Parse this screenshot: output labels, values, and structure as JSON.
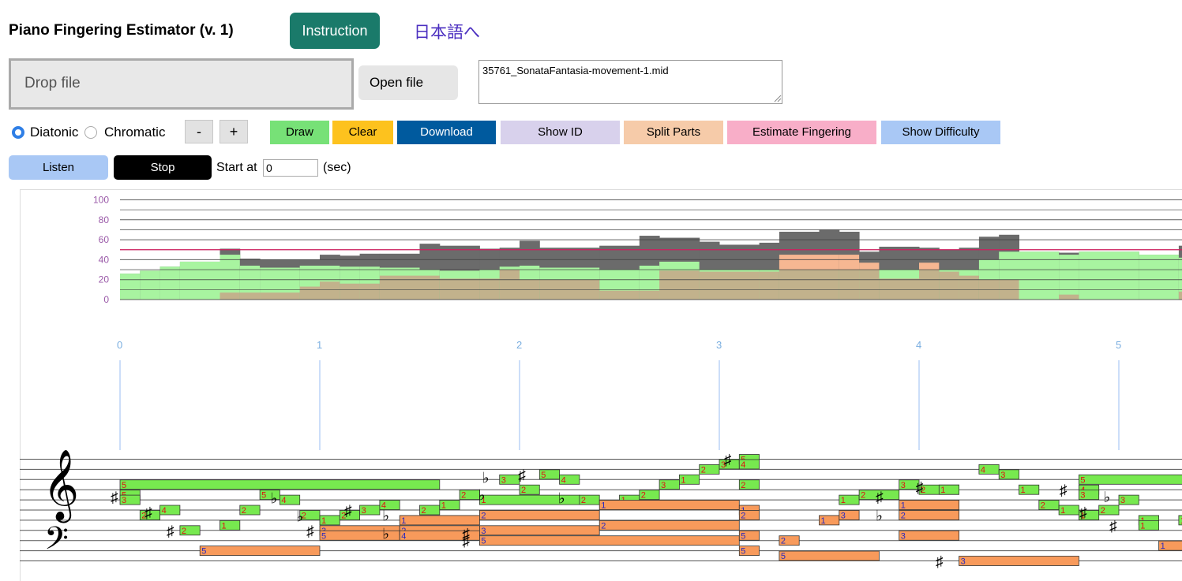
{
  "app": {
    "title": "Piano Fingering Estimator (v. 1)",
    "instruction_label": "Instruction",
    "language_link": "日本語へ"
  },
  "file": {
    "drop_label": "Drop file",
    "open_label": "Open file",
    "filename": "35761_SonataFantasia-movement-1.mid"
  },
  "controls": {
    "mode_options": [
      "Diatonic",
      "Chromatic"
    ],
    "mode_selected": "Diatonic",
    "zoom_out_label": "-",
    "zoom_in_label": "+",
    "toolbar": [
      {
        "label": "Draw",
        "color": "#77e177"
      },
      {
        "label": "Clear",
        "color": "#fdc21e"
      },
      {
        "label": "Download",
        "color": "#005a9e"
      },
      {
        "label": "Show ID",
        "color": "#d8d1ec"
      },
      {
        "label": "Split Parts",
        "color": "#f6cba9"
      },
      {
        "label": "Estimate Fingering",
        "color": "#f8aec8"
      },
      {
        "label": "Show Difficulty",
        "color": "#a9c8f5"
      }
    ],
    "listen_label": "Listen",
    "stop_label": "Stop",
    "start_at_label": "Start at",
    "start_value": "0",
    "sec_label": "(sec)"
  },
  "difficulty_chart": {
    "y_ticks": [
      "100",
      "80",
      "60",
      "40",
      "20",
      "0"
    ],
    "threshold": 50,
    "colors": {
      "total": "#6b6b6b",
      "right": "#a8f4a0",
      "left": "#c2b28c",
      "overlap": "#f6b792",
      "threshold": "#d02060"
    },
    "segments": [
      {
        "t0": 0.0,
        "t1": 0.1,
        "total": 26,
        "right": 26,
        "left": 0
      },
      {
        "t0": 0.1,
        "t1": 0.2,
        "total": 29,
        "right": 29,
        "left": 0
      },
      {
        "t0": 0.2,
        "t1": 0.3,
        "total": 33,
        "right": 33,
        "left": 0
      },
      {
        "t0": 0.3,
        "t1": 0.5,
        "total": 38,
        "right": 38,
        "left": 0
      },
      {
        "t0": 0.5,
        "t1": 0.6,
        "total": 51,
        "right": 45,
        "left": 7
      },
      {
        "t0": 0.6,
        "t1": 0.7,
        "total": 41,
        "right": 34,
        "left": 7
      },
      {
        "t0": 0.7,
        "t1": 0.9,
        "total": 40,
        "right": 32,
        "left": 7
      },
      {
        "t0": 0.9,
        "t1": 1.0,
        "total": 40,
        "right": 34,
        "left": 13
      },
      {
        "t0": 1.0,
        "t1": 1.1,
        "total": 45,
        "right": 34,
        "left": 18
      },
      {
        "t0": 1.1,
        "t1": 1.2,
        "total": 44,
        "right": 33,
        "left": 16
      },
      {
        "t0": 1.2,
        "t1": 1.3,
        "total": 46,
        "right": 33,
        "left": 16
      },
      {
        "t0": 1.3,
        "t1": 1.5,
        "total": 46,
        "right": 32,
        "left": 24
      },
      {
        "t0": 1.5,
        "t1": 1.6,
        "total": 56,
        "right": 30,
        "left": 24
      },
      {
        "t0": 1.6,
        "t1": 1.8,
        "total": 54,
        "right": 29,
        "left": 21
      },
      {
        "t0": 1.8,
        "t1": 1.9,
        "total": 51,
        "right": 30,
        "left": 21
      },
      {
        "t0": 1.9,
        "t1": 2.0,
        "total": 52,
        "right": 33,
        "left": 30
      },
      {
        "t0": 2.0,
        "t1": 2.1,
        "total": 59,
        "right": 34,
        "left": 20
      },
      {
        "t0": 2.1,
        "t1": 2.4,
        "total": 52,
        "right": 32,
        "left": 20
      },
      {
        "t0": 2.4,
        "t1": 2.6,
        "total": 54,
        "right": 30,
        "left": 9
      },
      {
        "t0": 2.6,
        "t1": 2.7,
        "total": 64,
        "right": 34,
        "left": 9
      },
      {
        "t0": 2.7,
        "t1": 2.9,
        "total": 62,
        "right": 38,
        "left": 29
      },
      {
        "t0": 2.9,
        "t1": 3.0,
        "total": 58,
        "right": 30,
        "left": 28
      },
      {
        "t0": 3.0,
        "t1": 3.2,
        "total": 55,
        "right": 30,
        "left": 28
      },
      {
        "t0": 3.2,
        "t1": 3.3,
        "total": 57,
        "right": 30,
        "left": 28
      },
      {
        "t0": 3.3,
        "t1": 3.5,
        "total": 68,
        "right": 30,
        "left": 45
      },
      {
        "t0": 3.5,
        "t1": 3.6,
        "total": 70,
        "right": 30,
        "left": 45
      },
      {
        "t0": 3.6,
        "t1": 3.7,
        "total": 68,
        "right": 30,
        "left": 45
      },
      {
        "t0": 3.7,
        "t1": 3.8,
        "total": 48,
        "right": 30,
        "left": 37
      },
      {
        "t0": 3.8,
        "t1": 4.0,
        "total": 53,
        "right": 30,
        "left": 21
      },
      {
        "t0": 4.0,
        "t1": 4.1,
        "total": 52,
        "right": 30,
        "left": 37
      },
      {
        "t0": 4.1,
        "t1": 4.2,
        "total": 50,
        "right": 30,
        "left": 28
      },
      {
        "t0": 4.2,
        "t1": 4.3,
        "total": 52,
        "right": 30,
        "left": 24
      },
      {
        "t0": 4.3,
        "t1": 4.4,
        "total": 63,
        "right": 40,
        "left": 20
      },
      {
        "t0": 4.4,
        "t1": 4.5,
        "total": 65,
        "right": 48,
        "left": 20
      },
      {
        "t0": 4.5,
        "t1": 4.7,
        "total": 48,
        "right": 48,
        "left": 0
      },
      {
        "t0": 4.7,
        "t1": 4.8,
        "total": 47,
        "right": 45,
        "left": 5
      },
      {
        "t0": 4.8,
        "t1": 5.1,
        "total": 48,
        "right": 48,
        "left": 0
      },
      {
        "t0": 5.1,
        "t1": 5.3,
        "total": 45,
        "right": 45,
        "left": 0
      },
      {
        "t0": 5.3,
        "t1": 5.4,
        "total": 54,
        "right": 42,
        "left": 8
      }
    ]
  },
  "timeline": {
    "labels": [
      "0",
      "1",
      "2",
      "3",
      "4",
      "5"
    ]
  },
  "score": {
    "colors": {
      "right_fill": "#77e94f",
      "left_fill": "#f89a5b",
      "right_text": "#e01010",
      "left_text": "#2828c0"
    },
    "notes": [
      {
        "hand": "R",
        "t0": 0.0,
        "t1": 1.6,
        "line": 2.5,
        "finger": "5"
      },
      {
        "hand": "R",
        "t0": 0.0,
        "t1": 0.1,
        "line": 3.5,
        "finger": "5"
      },
      {
        "hand": "R",
        "t0": 0.0,
        "t1": 0.1,
        "line": 4.0,
        "finger": "3"
      },
      {
        "hand": "R",
        "t0": 0.1,
        "t1": 0.2,
        "line": 5.5,
        "finger": "2"
      },
      {
        "hand": "R",
        "t0": 0.2,
        "t1": 0.3,
        "line": 5.0,
        "finger": "4"
      },
      {
        "hand": "R",
        "t0": 0.3,
        "t1": 0.4,
        "line": 7.0,
        "finger": "2"
      },
      {
        "hand": "R",
        "t0": 0.5,
        "t1": 0.6,
        "line": 6.5,
        "finger": "1"
      },
      {
        "hand": "R",
        "t0": 0.6,
        "t1": 0.7,
        "line": 5.0,
        "finger": "2"
      },
      {
        "hand": "R",
        "t0": 0.7,
        "t1": 0.8,
        "line": 3.5,
        "finger": "5"
      },
      {
        "hand": "R",
        "t0": 0.8,
        "t1": 0.9,
        "line": 4.0,
        "finger": "4"
      },
      {
        "hand": "R",
        "t0": 0.9,
        "t1": 1.0,
        "line": 5.5,
        "finger": "2"
      },
      {
        "hand": "R",
        "t0": 1.0,
        "t1": 1.1,
        "line": 6.0,
        "finger": "1"
      },
      {
        "hand": "R",
        "t0": 1.1,
        "t1": 1.2,
        "line": 5.5,
        "finger": "2"
      },
      {
        "hand": "R",
        "t0": 1.2,
        "t1": 1.3,
        "line": 5.0,
        "finger": "3"
      },
      {
        "hand": "R",
        "t0": 1.3,
        "t1": 1.4,
        "line": 4.5,
        "finger": "4"
      },
      {
        "hand": "R",
        "t0": 1.5,
        "t1": 1.6,
        "line": 5.0,
        "finger": "2"
      },
      {
        "hand": "R",
        "t0": 1.6,
        "t1": 1.7,
        "line": 4.5,
        "finger": "1"
      },
      {
        "hand": "R",
        "t0": 1.7,
        "t1": 1.8,
        "line": 3.5,
        "finger": "2"
      },
      {
        "hand": "R",
        "t0": 1.8,
        "t1": 2.3,
        "line": 4.0,
        "finger": "1"
      },
      {
        "hand": "R",
        "t0": 1.9,
        "t1": 2.0,
        "line": 2.0,
        "finger": "3"
      },
      {
        "hand": "R",
        "t0": 2.0,
        "t1": 2.1,
        "line": 3.0,
        "finger": "2"
      },
      {
        "hand": "R",
        "t0": 2.1,
        "t1": 2.2,
        "line": 1.5,
        "finger": "5"
      },
      {
        "hand": "R",
        "t0": 2.2,
        "t1": 2.3,
        "line": 2.0,
        "finger": "4"
      },
      {
        "hand": "R",
        "t0": 2.3,
        "t1": 2.4,
        "line": 4.0,
        "finger": "2"
      },
      {
        "hand": "R",
        "t0": 2.5,
        "t1": 2.6,
        "line": 4.0,
        "finger": "1"
      },
      {
        "hand": "R",
        "t0": 2.6,
        "t1": 2.7,
        "line": 3.5,
        "finger": "2"
      },
      {
        "hand": "R",
        "t0": 2.7,
        "t1": 2.8,
        "line": 2.5,
        "finger": "3"
      },
      {
        "hand": "R",
        "t0": 2.8,
        "t1": 2.9,
        "line": 2.0,
        "finger": "1"
      },
      {
        "hand": "R",
        "t0": 2.9,
        "t1": 3.0,
        "line": 1.0,
        "finger": "2"
      },
      {
        "hand": "R",
        "t0": 3.0,
        "t1": 3.1,
        "line": 0.5,
        "finger": "3"
      },
      {
        "hand": "R",
        "t0": 3.1,
        "t1": 3.2,
        "line": 0.0,
        "finger": "5"
      },
      {
        "hand": "R",
        "t0": 3.1,
        "t1": 3.2,
        "line": 0.5,
        "finger": "4"
      },
      {
        "hand": "R",
        "t0": 3.1,
        "t1": 3.2,
        "line": 2.5,
        "finger": "2"
      },
      {
        "hand": "R",
        "t0": 3.6,
        "t1": 3.7,
        "line": 4.0,
        "finger": "1"
      },
      {
        "hand": "R",
        "t0": 3.7,
        "t1": 3.9,
        "line": 3.5,
        "finger": "2"
      },
      {
        "hand": "R",
        "t0": 3.9,
        "t1": 4.0,
        "line": 2.5,
        "finger": "3"
      },
      {
        "hand": "R",
        "t0": 4.0,
        "t1": 4.2,
        "line": 3.0,
        "finger": "2"
      },
      {
        "hand": "R",
        "t0": 4.1,
        "t1": 4.2,
        "line": 3.0,
        "finger": "1"
      },
      {
        "hand": "R",
        "t0": 4.3,
        "t1": 4.4,
        "line": 1.0,
        "finger": "4"
      },
      {
        "hand": "R",
        "t0": 4.4,
        "t1": 4.5,
        "line": 1.5,
        "finger": "3"
      },
      {
        "hand": "R",
        "t0": 4.5,
        "t1": 4.6,
        "line": 3.0,
        "finger": "1"
      },
      {
        "hand": "R",
        "t0": 4.6,
        "t1": 4.7,
        "line": 4.5,
        "finger": "2"
      },
      {
        "hand": "R",
        "t0": 4.7,
        "t1": 4.8,
        "line": 5.0,
        "finger": "1"
      },
      {
        "hand": "R",
        "t0": 4.8,
        "t1": 5.4,
        "line": 2.0,
        "finger": "5"
      },
      {
        "hand": "R",
        "t0": 4.8,
        "t1": 4.9,
        "line": 3.0,
        "finger": "4"
      },
      {
        "hand": "R",
        "t0": 4.8,
        "t1": 4.9,
        "line": 3.5,
        "finger": "3"
      },
      {
        "hand": "R",
        "t0": 4.8,
        "t1": 4.9,
        "line": 5.5,
        "finger": "1"
      },
      {
        "hand": "R",
        "t0": 4.9,
        "t1": 5.0,
        "line": 5.0,
        "finger": "2"
      },
      {
        "hand": "R",
        "t0": 5.0,
        "t1": 5.1,
        "line": 4.0,
        "finger": "3"
      },
      {
        "hand": "R",
        "t0": 5.1,
        "t1": 5.2,
        "line": 6.0,
        "finger": "1"
      },
      {
        "hand": "R",
        "t0": 5.1,
        "t1": 5.2,
        "line": 6.5,
        "finger": "1"
      },
      {
        "hand": "R",
        "t0": 5.3,
        "t1": 5.4,
        "line": 6.0,
        "finger": "1"
      },
      {
        "hand": "L",
        "t0": 0.4,
        "t1": 1.0,
        "line": 9.0,
        "finger": "5"
      },
      {
        "hand": "L",
        "t0": 1.0,
        "t1": 1.4,
        "line": 7.0,
        "finger": "3"
      },
      {
        "hand": "L",
        "t0": 1.0,
        "t1": 1.4,
        "line": 7.5,
        "finger": "5"
      },
      {
        "hand": "L",
        "t0": 1.4,
        "t1": 1.8,
        "line": 6.0,
        "finger": "1"
      },
      {
        "hand": "L",
        "t0": 1.4,
        "t1": 1.8,
        "line": 7.0,
        "finger": "2"
      },
      {
        "hand": "L",
        "t0": 1.4,
        "t1": 1.8,
        "line": 7.5,
        "finger": "4"
      },
      {
        "hand": "L",
        "t0": 1.8,
        "t1": 2.4,
        "line": 5.5,
        "finger": "2"
      },
      {
        "hand": "L",
        "t0": 1.8,
        "t1": 2.4,
        "line": 7.0,
        "finger": "3"
      },
      {
        "hand": "L",
        "t0": 1.8,
        "t1": 3.1,
        "line": 8.0,
        "finger": "5"
      },
      {
        "hand": "L",
        "t0": 2.4,
        "t1": 3.1,
        "line": 4.5,
        "finger": "1"
      },
      {
        "hand": "L",
        "t0": 2.4,
        "t1": 3.1,
        "line": 6.5,
        "finger": "2"
      },
      {
        "hand": "L",
        "t0": 3.1,
        "t1": 3.2,
        "line": 5.0,
        "finger": "1"
      },
      {
        "hand": "L",
        "t0": 3.1,
        "t1": 3.2,
        "line": 5.5,
        "finger": "2"
      },
      {
        "hand": "L",
        "t0": 3.1,
        "t1": 3.2,
        "line": 7.5,
        "finger": "5"
      },
      {
        "hand": "L",
        "t0": 3.1,
        "t1": 3.2,
        "line": 9.0,
        "finger": "5"
      },
      {
        "hand": "L",
        "t0": 3.3,
        "t1": 3.4,
        "line": 8.0,
        "finger": "2"
      },
      {
        "hand": "L",
        "t0": 3.3,
        "t1": 3.8,
        "line": 9.5,
        "finger": "5"
      },
      {
        "hand": "L",
        "t0": 3.5,
        "t1": 3.6,
        "line": 6.0,
        "finger": "1"
      },
      {
        "hand": "L",
        "t0": 3.6,
        "t1": 3.7,
        "line": 5.5,
        "finger": "3"
      },
      {
        "hand": "L",
        "t0": 3.9,
        "t1": 4.2,
        "line": 4.5,
        "finger": "1"
      },
      {
        "hand": "L",
        "t0": 3.9,
        "t1": 4.2,
        "line": 5.5,
        "finger": "2"
      },
      {
        "hand": "L",
        "t0": 3.9,
        "t1": 4.2,
        "line": 7.5,
        "finger": "3"
      },
      {
        "hand": "L",
        "t0": 4.2,
        "t1": 4.8,
        "line": 10.0,
        "finger": "3"
      },
      {
        "hand": "L",
        "t0": 5.2,
        "t1": 5.4,
        "line": 8.5,
        "finger": "1"
      }
    ],
    "accidentals": [
      {
        "t": 0.0,
        "line": 3.7,
        "glyph": "♯"
      },
      {
        "t": 0.17,
        "line": 5.2,
        "glyph": "♯"
      },
      {
        "t": 0.28,
        "line": 7.0,
        "glyph": "♯"
      },
      {
        "t": 0.8,
        "line": 3.8,
        "glyph": "♭"
      },
      {
        "t": 0.93,
        "line": 5.6,
        "glyph": "♭"
      },
      {
        "t": 0.98,
        "line": 7.0,
        "glyph": "♯"
      },
      {
        "t": 1.17,
        "line": 5.0,
        "glyph": "♯"
      },
      {
        "t": 1.36,
        "line": 5.5,
        "glyph": "♭"
      },
      {
        "t": 1.36,
        "line": 7.3,
        "glyph": "♭"
      },
      {
        "t": 1.76,
        "line": 7.3,
        "glyph": "♯"
      },
      {
        "t": 1.76,
        "line": 8.0,
        "glyph": "♯"
      },
      {
        "t": 1.84,
        "line": 3.5,
        "glyph": "♭"
      },
      {
        "t": 1.86,
        "line": 1.8,
        "glyph": "♭"
      },
      {
        "t": 2.04,
        "line": 1.5,
        "glyph": "♯"
      },
      {
        "t": 2.24,
        "line": 3.8,
        "glyph": "♭"
      },
      {
        "t": 3.07,
        "line": 0.0,
        "glyph": "♯"
      },
      {
        "t": 3.83,
        "line": 3.7,
        "glyph": "♯"
      },
      {
        "t": 3.83,
        "line": 5.5,
        "glyph": "♭"
      },
      {
        "t": 4.03,
        "line": 2.7,
        "glyph": "♯"
      },
      {
        "t": 4.13,
        "line": 10.0,
        "glyph": "♯"
      },
      {
        "t": 4.75,
        "line": 3.0,
        "glyph": "♯"
      },
      {
        "t": 4.85,
        "line": 5.2,
        "glyph": "♯"
      },
      {
        "t": 4.97,
        "line": 3.7,
        "glyph": "♭"
      },
      {
        "t": 5.0,
        "line": 6.5,
        "glyph": "♯"
      }
    ]
  }
}
